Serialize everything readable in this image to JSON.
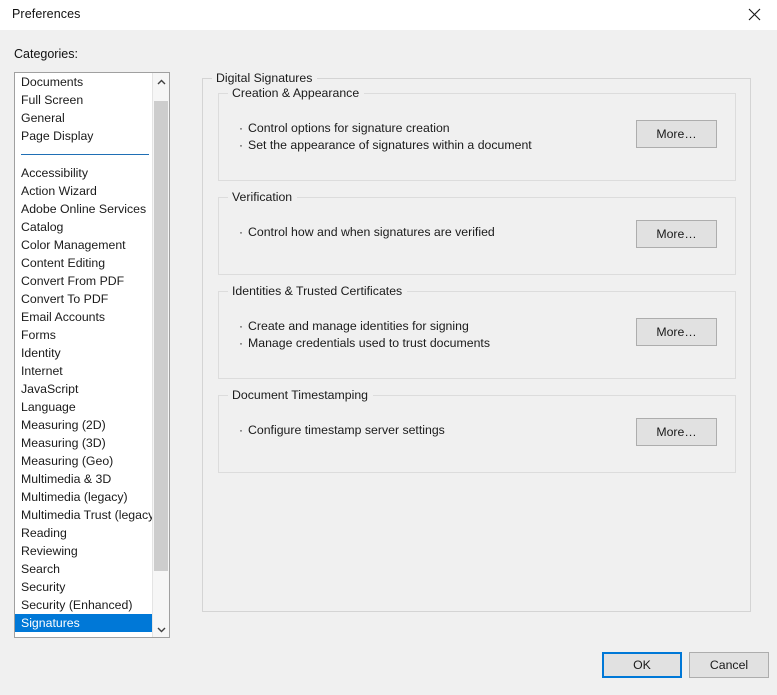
{
  "window": {
    "title": "Preferences",
    "close_icon": "close-icon"
  },
  "sidebar": {
    "label": "Categories:",
    "top_items": [
      {
        "label": "Documents"
      },
      {
        "label": "Full Screen"
      },
      {
        "label": "General"
      },
      {
        "label": "Page Display"
      }
    ],
    "items": [
      {
        "label": "Accessibility"
      },
      {
        "label": "Action Wizard"
      },
      {
        "label": "Adobe Online Services"
      },
      {
        "label": "Catalog"
      },
      {
        "label": "Color Management"
      },
      {
        "label": "Content Editing"
      },
      {
        "label": "Convert From PDF"
      },
      {
        "label": "Convert To PDF"
      },
      {
        "label": "Email Accounts"
      },
      {
        "label": "Forms"
      },
      {
        "label": "Identity"
      },
      {
        "label": "Internet"
      },
      {
        "label": "JavaScript"
      },
      {
        "label": "Language"
      },
      {
        "label": "Measuring (2D)"
      },
      {
        "label": "Measuring (3D)"
      },
      {
        "label": "Measuring (Geo)"
      },
      {
        "label": "Multimedia & 3D"
      },
      {
        "label": "Multimedia (legacy)"
      },
      {
        "label": "Multimedia Trust (legacy)"
      },
      {
        "label": "Reading"
      },
      {
        "label": "Reviewing"
      },
      {
        "label": "Search"
      },
      {
        "label": "Security"
      },
      {
        "label": "Security (Enhanced)"
      },
      {
        "label": "Signatures",
        "selected": true
      }
    ],
    "selected": "Signatures",
    "scroll_up_icon": "chevron-up-icon",
    "scroll_down_icon": "chevron-down-icon",
    "selection_color": "#0078d7",
    "separator_color": "#1f6fb5"
  },
  "main": {
    "group_title": "Digital Signatures",
    "sections": [
      {
        "title": "Creation & Appearance",
        "bullets": [
          "Control options for signature creation",
          "Set the appearance of signatures within a document"
        ],
        "button": "More…"
      },
      {
        "title": "Verification",
        "bullets": [
          "Control how and when signatures are verified"
        ],
        "button": "More…"
      },
      {
        "title": "Identities & Trusted Certificates",
        "bullets": [
          "Create and manage identities for signing",
          "Manage credentials used to trust documents"
        ],
        "button": "More…"
      },
      {
        "title": "Document Timestamping",
        "bullets": [
          "Configure timestamp server settings"
        ],
        "button": "More…"
      }
    ]
  },
  "footer": {
    "ok_label": "OK",
    "cancel_label": "Cancel",
    "focus_color": "#0078d7"
  }
}
